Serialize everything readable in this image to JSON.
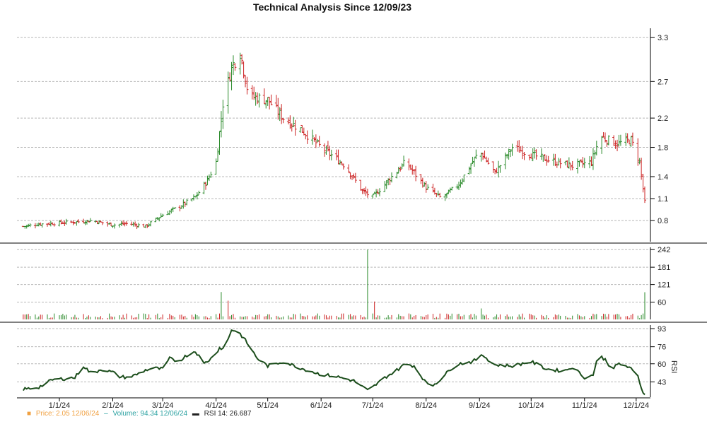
{
  "chart_data": [
    {
      "type": "ohlc",
      "panel": "price",
      "title": "Technical Analysis Since 12/09/23",
      "ylim": [
        0.55,
        3.35
      ],
      "yticks": [
        "3.3",
        "2.7",
        "2.2",
        "1.8",
        "1.4",
        "1.1",
        "0.8"
      ],
      "ytick_values": [
        3.3,
        2.7,
        2.2,
        1.8,
        1.4,
        1.1,
        0.8
      ],
      "xticks": [
        "1/1/24",
        "2/1/24",
        "3/1/24",
        "4/1/24",
        "5/1/24",
        "6/1/24",
        "7/1/24",
        "8/1/24",
        "9/1/24",
        "10/1/24",
        "11/1/24",
        "12/1/24"
      ],
      "xtick_dates": [
        "2024-01-01",
        "2024-02-01",
        "2024-03-01",
        "2024-04-01",
        "2024-05-01",
        "2024-06-01",
        "2024-07-01",
        "2024-08-01",
        "2024-09-01",
        "2024-10-01",
        "2024-11-01",
        "2024-12-01"
      ],
      "close_anchors": {
        "date": [
          "2023-12-11",
          "2023-12-20",
          "2024-01-10",
          "2024-01-20",
          "2024-02-01",
          "2024-02-10",
          "2024-02-20",
          "2024-03-01",
          "2024-03-10",
          "2024-03-20",
          "2024-03-27",
          "2024-04-01",
          "2024-04-05",
          "2024-04-10",
          "2024-04-15",
          "2024-04-20",
          "2024-05-01",
          "2024-05-10",
          "2024-05-20",
          "2024-06-01",
          "2024-06-15",
          "2024-06-25",
          "2024-07-01",
          "2024-07-10",
          "2024-07-20",
          "2024-08-01",
          "2024-08-10",
          "2024-08-20",
          "2024-09-01",
          "2024-09-10",
          "2024-09-20",
          "2024-10-01",
          "2024-10-15",
          "2024-10-25",
          "2024-11-05",
          "2024-11-10",
          "2024-11-20",
          "2024-11-28",
          "2024-12-03",
          "2024-12-06"
        ],
        "close": [
          0.72,
          0.75,
          0.78,
          0.8,
          0.74,
          0.76,
          0.72,
          0.88,
          0.98,
          1.12,
          1.35,
          1.6,
          2.4,
          2.9,
          3.1,
          2.5,
          2.45,
          2.2,
          2.05,
          1.8,
          1.55,
          1.2,
          1.12,
          1.35,
          1.6,
          1.25,
          1.1,
          1.3,
          1.75,
          1.45,
          1.8,
          1.7,
          1.6,
          1.55,
          1.6,
          1.95,
          1.85,
          1.9,
          1.6,
          1.05
        ]
      }
    },
    {
      "type": "bar",
      "panel": "volume",
      "ylim": [
        0,
        245
      ],
      "yticks": [
        "242",
        "181",
        "121",
        "60"
      ],
      "ytick_values": [
        242,
        181,
        121,
        60
      ],
      "spikes": [
        {
          "date": "2024-04-04",
          "value": 95
        },
        {
          "date": "2024-04-08",
          "value": 65
        },
        {
          "date": "2024-06-28",
          "value": 242
        },
        {
          "date": "2024-07-02",
          "value": 62
        },
        {
          "date": "2024-09-02",
          "value": 38
        },
        {
          "date": "2024-12-06",
          "value": 94.34
        }
      ],
      "base_value": 18
    },
    {
      "type": "line",
      "panel": "rsi",
      "ylabel": "RSI",
      "ylim": [
        30,
        95
      ],
      "yticks": [
        "93",
        "76",
        "60",
        "43"
      ],
      "ytick_values": [
        93,
        76,
        60,
        43
      ],
      "series": [
        {
          "date": [
            "2023-12-11",
            "2023-12-20",
            "2023-12-28",
            "2024-01-10",
            "2024-01-15",
            "2024-01-20",
            "2024-01-25",
            "2024-02-01",
            "2024-02-05",
            "2024-02-10",
            "2024-02-15",
            "2024-02-20",
            "2024-02-25",
            "2024-03-01",
            "2024-03-05",
            "2024-03-10",
            "2024-03-15",
            "2024-03-20",
            "2024-03-25",
            "2024-03-30",
            "2024-04-03",
            "2024-04-06",
            "2024-04-10",
            "2024-04-14",
            "2024-04-18",
            "2024-04-25",
            "2024-05-01",
            "2024-05-10",
            "2024-05-20",
            "2024-06-01",
            "2024-06-10",
            "2024-06-20",
            "2024-06-28",
            "2024-07-01",
            "2024-07-08",
            "2024-07-15",
            "2024-07-20",
            "2024-07-25",
            "2024-08-01",
            "2024-08-05",
            "2024-08-10",
            "2024-08-15",
            "2024-08-20",
            "2024-08-28",
            "2024-09-03",
            "2024-09-10",
            "2024-09-20",
            "2024-10-01",
            "2024-10-05",
            "2024-10-10",
            "2024-10-20",
            "2024-10-25",
            "2024-10-30",
            "2024-11-02",
            "2024-11-06",
            "2024-11-09",
            "2024-11-13",
            "2024-11-17",
            "2024-11-21",
            "2024-11-25",
            "2024-11-28",
            "2024-12-02",
            "2024-12-04",
            "2024-12-06"
          ],
          "rsi": [
            36,
            38,
            45,
            47,
            58,
            50,
            55,
            52,
            48,
            47,
            50,
            54,
            56,
            55,
            65,
            62,
            68,
            72,
            60,
            66,
            75,
            74,
            92,
            90,
            82,
            65,
            58,
            62,
            56,
            50,
            48,
            44,
            35,
            38,
            47,
            54,
            60,
            58,
            42,
            40,
            46,
            55,
            60,
            62,
            68,
            59,
            58,
            62,
            59,
            55,
            53,
            57,
            50,
            46,
            50,
            68,
            64,
            55,
            60,
            58,
            55,
            48,
            38,
            26.687
          ]
        }
      ]
    }
  ],
  "legend": {
    "price": "Price: 2.05  12/06/24",
    "volume": "Volume: 94.34  12/06/24",
    "rsi": "RSI 14: 26.687"
  },
  "colors": {
    "up": "#2a8a2a",
    "down": "#cc2222",
    "rsi_line": "#1b4d1b",
    "price_legend": "#f0a040",
    "volume_legend": "#2aa1a1"
  }
}
